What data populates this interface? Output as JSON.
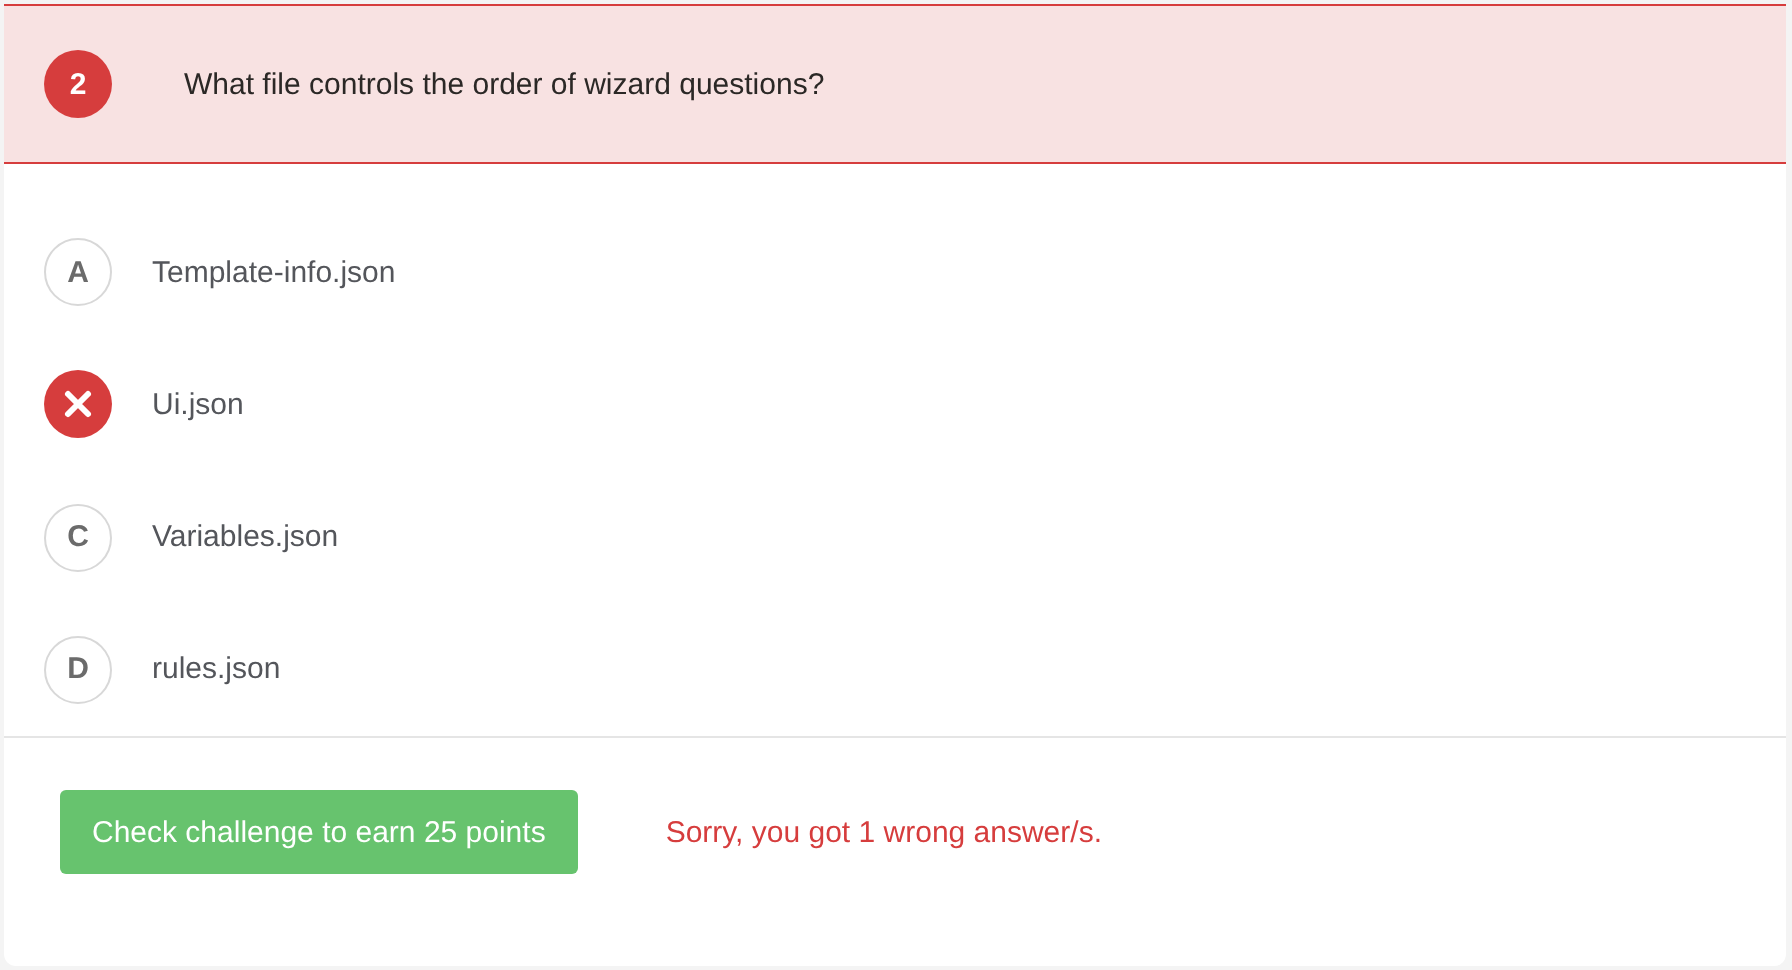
{
  "question": {
    "number": "2",
    "text": "What file controls the order of wizard questions?",
    "answered_wrong": true
  },
  "options": [
    {
      "letter": "A",
      "label": "Template-info.json",
      "wrong": false
    },
    {
      "label": "Ui.json",
      "wrong": true
    },
    {
      "letter": "C",
      "label": "Variables.json",
      "wrong": false
    },
    {
      "letter": "D",
      "label": "rules.json",
      "wrong": false
    }
  ],
  "check_button": "Check challenge to earn 25 points",
  "result_message": "Sorry, you got 1 wrong answer/s."
}
